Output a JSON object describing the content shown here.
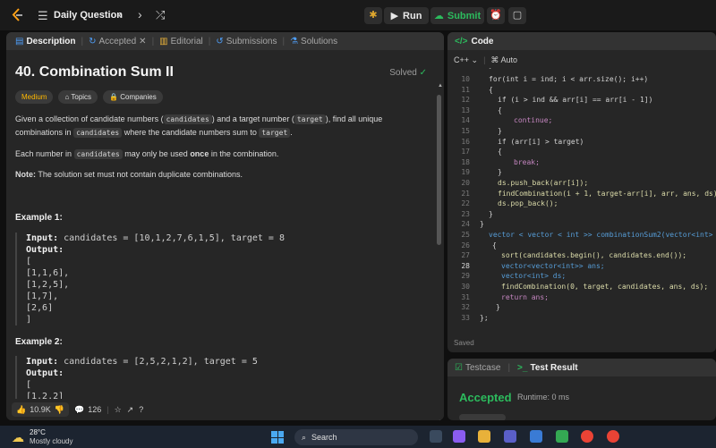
{
  "topbar": {
    "playlist_title": "Daily Question",
    "run_label": "Run",
    "submit_label": "Submit"
  },
  "left_tabs": [
    {
      "label": "Description"
    },
    {
      "label": "Accepted"
    },
    {
      "label": "Editorial"
    },
    {
      "label": "Submissions"
    },
    {
      "label": "Solutions"
    }
  ],
  "problem": {
    "title": "40. Combination Sum II",
    "status": "Solved",
    "difficulty": "Medium",
    "topics_label": "Topics",
    "companies_label": "Companies",
    "p1_a": "Given a collection of candidate numbers (",
    "p1_code1": "candidates",
    "p1_b": ") and a target number (",
    "p1_code2": "target",
    "p1_c": "), find all unique combinations in",
    "p1_code3": "candidates",
    "p1_d": "where the candidate numbers sum to",
    "p1_code4": "target",
    "p1_e": ".",
    "p2_a": "Each number in",
    "p2_code": "candidates",
    "p2_b": "may only be used",
    "p2_bold": "once",
    "p2_c": "in the combination.",
    "note_label": "Note:",
    "note_text": "The solution set must not contain duplicate combinations."
  },
  "example1": {
    "title": "Example 1:",
    "input_label": "Input:",
    "input_value": "candidates = [10,1,2,7,6,1,5], target = 8",
    "output_label": "Output:",
    "output_lines": [
      "[",
      "[1,1,6],",
      "[1,2,5],",
      "[1,7],",
      "[2,6]",
      "]"
    ]
  },
  "example2": {
    "title": "Example 2:",
    "input_label": "Input:",
    "input_value": "candidates = [2,5,2,1,2], target = 5",
    "output_label": "Output:",
    "output_lines": [
      "[",
      "[1,2,2]"
    ]
  },
  "footer": {
    "likes": "10.9K",
    "comments": "126"
  },
  "code_panel": {
    "title": "Code",
    "language": "C++",
    "mode": "Auto",
    "saved": "Saved",
    "lines": [
      {
        "n": "10",
        "t": "for(int i = ind; i < arr.size(); i++)"
      },
      {
        "n": "11",
        "t": "{"
      },
      {
        "n": "12",
        "t": "if (i > ind && arr[i] == arr[i - 1])"
      },
      {
        "n": "13",
        "t": "{"
      },
      {
        "n": "14",
        "t": "continue;"
      },
      {
        "n": "15",
        "t": "}"
      },
      {
        "n": "16",
        "t": "if (arr[i] > target)"
      },
      {
        "n": "17",
        "t": "{"
      },
      {
        "n": "18",
        "t": "break;"
      },
      {
        "n": "19",
        "t": "}"
      },
      {
        "n": "20",
        "t": "ds.push_back(arr[i]);"
      },
      {
        "n": "21",
        "t": "findCombination(i + 1, target-arr[i], arr, ans, ds);"
      },
      {
        "n": "22",
        "t": "ds.pop_back();"
      },
      {
        "n": "23",
        "t": "}"
      },
      {
        "n": "24",
        "t": "}"
      },
      {
        "n": "25",
        "t": "vector < vector < int >> combinationSum2(vector<int> &"
      },
      {
        "n": "26",
        "t": "{"
      },
      {
        "n": "27",
        "t": "sort(candidates.begin(), candidates.end());"
      },
      {
        "n": "28",
        "t": "vector<vector<int>> ans;"
      },
      {
        "n": "29",
        "t": "vector<int> ds;"
      },
      {
        "n": "30",
        "t": "findCombination(0, target, candidates, ans, ds);"
      },
      {
        "n": "31",
        "t": "return ans;"
      },
      {
        "n": "32",
        "t": "}"
      },
      {
        "n": "33",
        "t": "};"
      }
    ]
  },
  "result_panel": {
    "tab1": "Testcase",
    "tab2": "Test Result",
    "status": "Accepted",
    "runtime": "Runtime: 0 ms"
  },
  "taskbar": {
    "temperature": "28°C",
    "weather": "Mostly cloudy",
    "search_label": "Search"
  }
}
